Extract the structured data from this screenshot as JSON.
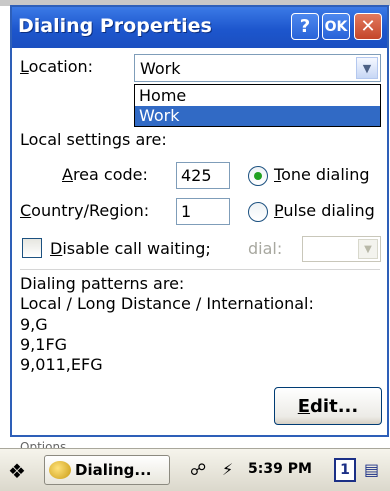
{
  "dialog": {
    "title": "Dialing Properties",
    "help_label": "?",
    "ok_label": "OK",
    "close_label": "✕"
  },
  "location": {
    "label_ul": "L",
    "label_rest": "ocation:",
    "value": "Work",
    "options": [
      "Home",
      "Work"
    ],
    "selected": "Work"
  },
  "local_settings": {
    "heading": "Local settings are:",
    "area_code_label_pre": "",
    "area_code_label_ul": "A",
    "area_code_label_rest": "rea code:",
    "area_code_value": "425",
    "country_label_ul": "C",
    "country_label_rest": "ountry/Region:",
    "country_value": "1",
    "tone_label_ul": "T",
    "tone_label_rest": "one dialing",
    "pulse_label_ul": "P",
    "pulse_label_rest": "ulse dialing",
    "tone_selected": true
  },
  "call_waiting": {
    "label_ul": "D",
    "label_rest": "isable call waiting;",
    "dial_label": "dial:",
    "checked": false
  },
  "patterns": {
    "heading": "Dialing patterns are:",
    "subheading": "Local / Long Distance / International:",
    "local": "9,G",
    "long_distance": "9,1FG",
    "international": "9,011,EFG"
  },
  "edit_button": {
    "label_ul": "E",
    "label_rest": "dit..."
  },
  "background_text": "Options",
  "taskbar": {
    "task_label": "Dialing...",
    "time": "5:39 PM",
    "page_number": "1"
  },
  "colors": {
    "titlebar": "#1d56cd",
    "selection": "#316ac5",
    "radio_dot": "#21a121"
  }
}
